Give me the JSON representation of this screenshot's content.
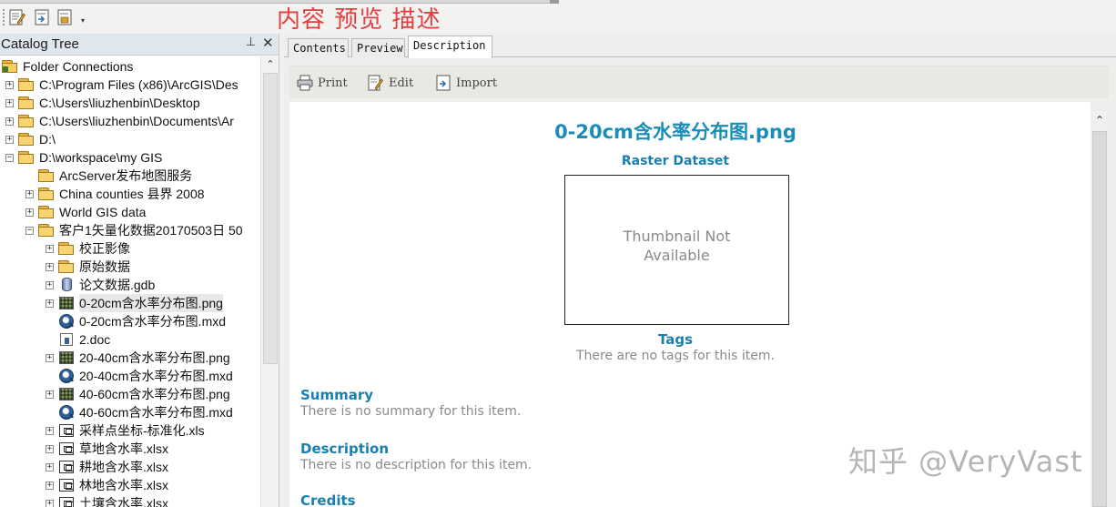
{
  "annotation": "内容 预览 描述",
  "catalog": {
    "title": "Catalog Tree",
    "pin_icon": "pin-icon",
    "close_icon": "close-icon",
    "items": [
      {
        "label": "Folder Connections",
        "icon": "folder-connection-icon",
        "expander": "",
        "level": 0
      },
      {
        "label": "C:\\Program Files (x86)\\ArcGIS\\Des",
        "icon": "folder-icon",
        "expander": "+",
        "level": 1
      },
      {
        "label": "C:\\Users\\liuzhenbin\\Desktop",
        "icon": "folder-icon",
        "expander": "+",
        "level": 1
      },
      {
        "label": "C:\\Users\\liuzhenbin\\Documents\\Ar",
        "icon": "folder-icon",
        "expander": "+",
        "level": 1
      },
      {
        "label": "D:\\",
        "icon": "folder-icon",
        "expander": "+",
        "level": 1
      },
      {
        "label": "D:\\workspace\\my GIS",
        "icon": "folder-icon",
        "expander": "−",
        "level": 1
      },
      {
        "label": "ArcServer发布地图服务",
        "icon": "folder-icon",
        "expander": "",
        "level": 2
      },
      {
        "label": "China counties 县界 2008",
        "icon": "folder-icon",
        "expander": "+",
        "level": 2
      },
      {
        "label": "World GIS data",
        "icon": "folder-icon",
        "expander": "+",
        "level": 2
      },
      {
        "label": "客户1矢量化数据20170503日  50",
        "icon": "folder-icon",
        "expander": "−",
        "level": 2
      },
      {
        "label": "校正影像",
        "icon": "folder-icon",
        "expander": "+",
        "level": 3
      },
      {
        "label": "原始数据",
        "icon": "folder-icon",
        "expander": "+",
        "level": 3
      },
      {
        "label": "论文数据.gdb",
        "icon": "geodatabase-icon",
        "expander": "+",
        "level": 3
      },
      {
        "label": "0-20cm含水率分布图.png",
        "icon": "raster-icon",
        "expander": "+",
        "level": 3,
        "selected": true
      },
      {
        "label": "0-20cm含水率分布图.mxd",
        "icon": "map-document-icon",
        "expander": "",
        "level": 3
      },
      {
        "label": "2.doc",
        "icon": "word-document-icon",
        "expander": "",
        "level": 3
      },
      {
        "label": "20-40cm含水率分布图.png",
        "icon": "raster-icon",
        "expander": "+",
        "level": 3
      },
      {
        "label": "20-40cm含水率分布图.mxd",
        "icon": "map-document-icon",
        "expander": "",
        "level": 3
      },
      {
        "label": "40-60cm含水率分布图.png",
        "icon": "raster-icon",
        "expander": "+",
        "level": 3
      },
      {
        "label": "40-60cm含水率分布图.mxd",
        "icon": "map-document-icon",
        "expander": "",
        "level": 3
      },
      {
        "label": "采样点坐标-标准化.xls",
        "icon": "table-icon",
        "expander": "+",
        "level": 3
      },
      {
        "label": "草地含水率.xlsx",
        "icon": "table-icon",
        "expander": "+",
        "level": 3
      },
      {
        "label": "耕地含水率.xlsx",
        "icon": "table-icon",
        "expander": "+",
        "level": 3
      },
      {
        "label": "林地含水率.xlsx",
        "icon": "table-icon",
        "expander": "+",
        "level": 3
      },
      {
        "label": "土壤含水率.xlsx",
        "icon": "table-icon",
        "expander": "+",
        "level": 3
      }
    ]
  },
  "tabs": [
    {
      "label": "Contents",
      "active": false
    },
    {
      "label": "Preview",
      "active": false
    },
    {
      "label": "Description",
      "active": true
    }
  ],
  "desc_toolbar": {
    "print": "Print",
    "edit": "Edit",
    "import": "Import"
  },
  "description": {
    "title": "0-20cm含水率分布图.png",
    "type": "Raster Dataset",
    "thumbnail_text_1": "Thumbnail Not",
    "thumbnail_text_2": "Available",
    "tags_heading": "Tags",
    "tags_text": "There are no tags for this item.",
    "summary_heading": "Summary",
    "summary_text": "There is no summary for this item.",
    "description_heading": "Description",
    "description_text": "There is no description for this item.",
    "credits_heading": "Credits"
  },
  "watermark": "知乎 @VeryVast"
}
